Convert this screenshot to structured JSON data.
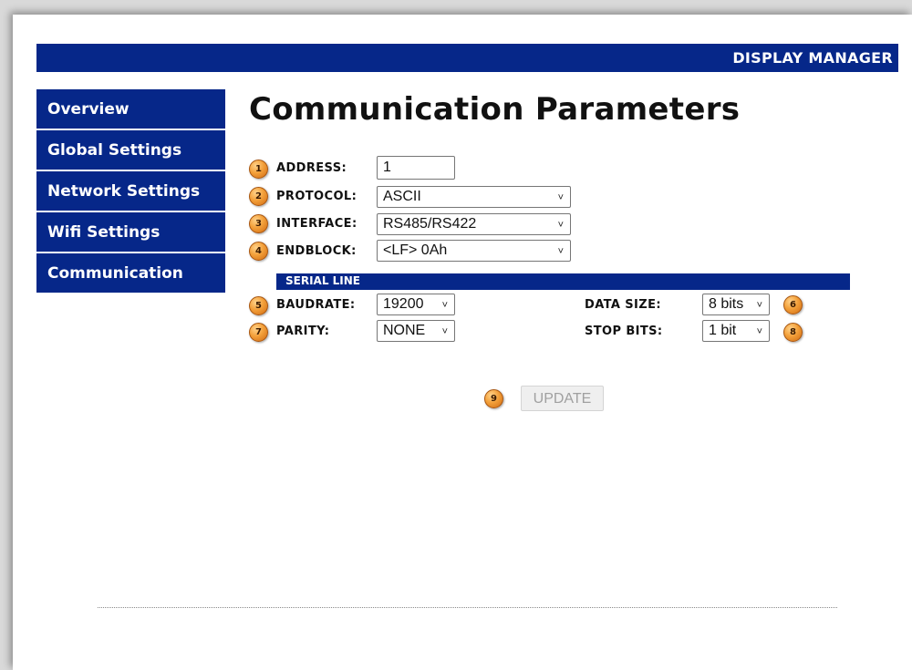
{
  "header": {
    "title": "DISPLAY MANAGER"
  },
  "nav": {
    "items": [
      {
        "label": "Overview"
      },
      {
        "label": "Global Settings"
      },
      {
        "label": "Network Settings"
      },
      {
        "label": "Wifi Settings"
      },
      {
        "label": "Communication"
      }
    ]
  },
  "page": {
    "title": "Communication Parameters"
  },
  "form": {
    "address": {
      "label": "ADDRESS:",
      "value": "1",
      "badge": "1"
    },
    "protocol": {
      "label": "PROTOCOL:",
      "value": "ASCII",
      "badge": "2"
    },
    "interface": {
      "label": "INTERFACE:",
      "value": "RS485/RS422",
      "badge": "3"
    },
    "endblock": {
      "label": "ENDBLOCK:",
      "value": "<LF> 0Ah",
      "badge": "4"
    }
  },
  "serial": {
    "title": "SERIAL LINE",
    "baudrate": {
      "label": "BAUDRATE:",
      "value": "19200",
      "badge": "5"
    },
    "datasize": {
      "label": "DATA SIZE:",
      "value": "8 bits",
      "badge": "6"
    },
    "parity": {
      "label": "PARITY:",
      "value": "NONE",
      "badge": "7"
    },
    "stopbits": {
      "label": "STOP BITS:",
      "value": "1 bit",
      "badge": "8"
    }
  },
  "update": {
    "label": "UPDATE",
    "badge": "9"
  },
  "colors": {
    "navy": "#062789",
    "badge_orange": "#f3a03a"
  }
}
